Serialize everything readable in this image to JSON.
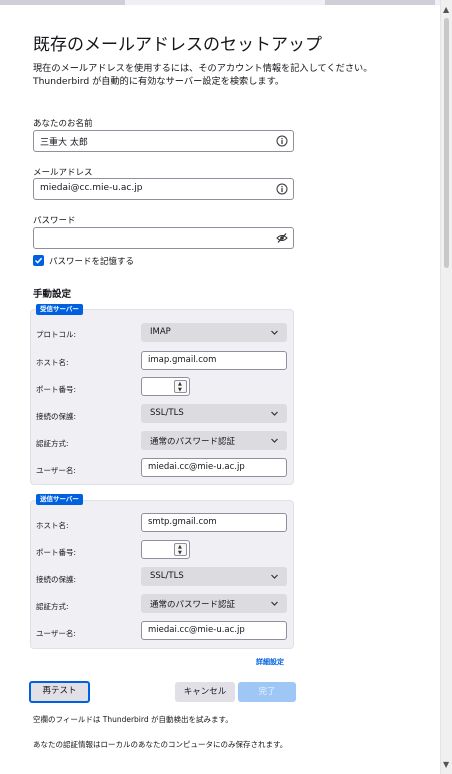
{
  "title": "既存のメールアドレスのセットアップ",
  "description": {
    "line1": "現在のメールアドレスを使用するには、そのアカウント情報を記入してください。",
    "line2": "Thunderbird が自動的に有効なサーバー設定を検索します。"
  },
  "name_field": {
    "label": "あなたのお名前",
    "value": "三重大 太郎",
    "icon": "info-icon"
  },
  "email_field": {
    "label": "メールアドレス",
    "value": "miedai@cc.mie-u.ac.jp",
    "icon": "info-icon"
  },
  "password_field": {
    "label": "パスワード",
    "value": "",
    "icon": "eye-slash-icon"
  },
  "remember_password": {
    "label": "パスワードを記憶する",
    "checked": true
  },
  "manual_settings": {
    "heading": "手動設定"
  },
  "incoming": {
    "badge": "受信サーバー",
    "protocol_label": "プロトコル:",
    "protocol_value": "IMAP",
    "host_label": "ホスト名:",
    "host_value": "imap.gmail.com",
    "port_label": "ポート番号:",
    "port_value": "",
    "security_label": "接続の保護:",
    "security_value": "SSL/TLS",
    "auth_label": "認証方式:",
    "auth_value": "通常のパスワード認証",
    "user_label": "ユーザー名:",
    "user_value": "miedai.cc@mie-u.ac.jp"
  },
  "outgoing": {
    "badge": "送信サーバー",
    "host_label": "ホスト名:",
    "host_value": "smtp.gmail.com",
    "port_label": "ポート番号:",
    "port_value": "",
    "security_label": "接続の保護:",
    "security_value": "SSL/TLS",
    "auth_label": "認証方式:",
    "auth_value": "通常のパスワード認証",
    "user_label": "ユーザー名:",
    "user_value": "miedai.cc@mie-u.ac.jp"
  },
  "advanced_link": "詳細設定",
  "buttons": {
    "retest": "再テスト",
    "cancel": "キャンセル",
    "done": "完了"
  },
  "notes": {
    "autodetect": "空欄のフィールドは Thunderbird が自動検出を試みます。",
    "credentials": "あなたの認証情報はローカルのあなたのコンピュータにのみ保存されます。"
  },
  "colors": {
    "accent": "#0061e0",
    "done_disabled": "#9fc7f5",
    "panel_bg": "#f0f0f4"
  }
}
